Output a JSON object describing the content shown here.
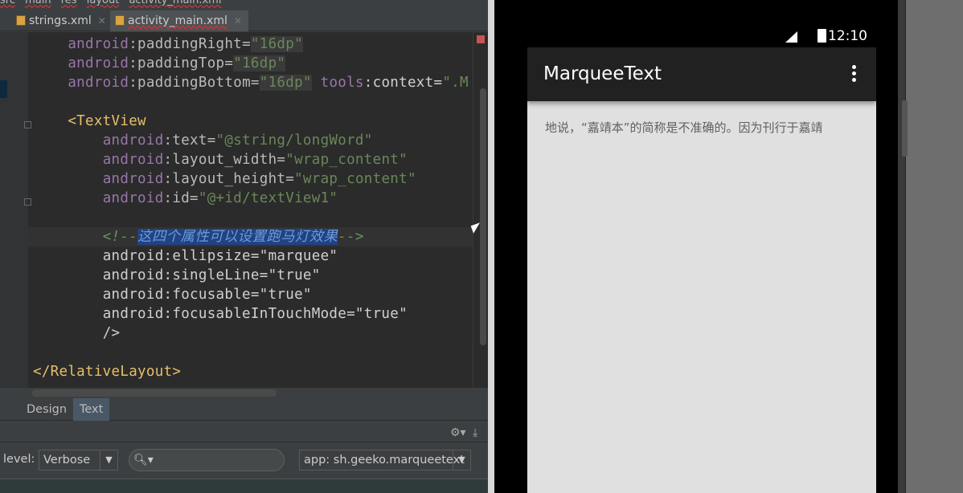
{
  "breadcrumb": [
    "src",
    "main",
    "res",
    "layout",
    "activity_main.xml"
  ],
  "editor_tabs": [
    {
      "label": "strings.xml",
      "active": false
    },
    {
      "label": "activity_main.xml",
      "active": true
    }
  ],
  "code_lines": [
    [
      [
        "    ",
        ""
      ],
      [
        "android",
        "ns"
      ],
      [
        ":paddingRight=",
        "at"
      ],
      [
        "\"16dp\"",
        "qd"
      ]
    ],
    [
      [
        "    ",
        ""
      ],
      [
        "android",
        "ns"
      ],
      [
        ":paddingTop=",
        "at"
      ],
      [
        "\"16dp\"",
        "qd"
      ]
    ],
    [
      [
        "    ",
        ""
      ],
      [
        "android",
        "ns"
      ],
      [
        ":paddingBottom=",
        "at"
      ],
      [
        "\"16dp\"",
        "qd"
      ],
      [
        " ",
        ""
      ],
      [
        "tools",
        "ns"
      ],
      [
        ":context=",
        "pl"
      ],
      [
        "\".M",
        "val"
      ]
    ],
    [],
    [
      [
        "    ",
        ""
      ],
      [
        "<TextView",
        "tag"
      ]
    ],
    [
      [
        "        ",
        ""
      ],
      [
        "android",
        "ns"
      ],
      [
        ":text=",
        "at"
      ],
      [
        "\"@string/longWord\"",
        "val"
      ]
    ],
    [
      [
        "        ",
        ""
      ],
      [
        "android",
        "ns"
      ],
      [
        ":layout_width=",
        "at"
      ],
      [
        "\"wrap_content\"",
        "val"
      ]
    ],
    [
      [
        "        ",
        ""
      ],
      [
        "android",
        "ns"
      ],
      [
        ":layout_height=",
        "at"
      ],
      [
        "\"wrap_content\"",
        "val"
      ]
    ],
    [
      [
        "        ",
        ""
      ],
      [
        "android",
        "ns"
      ],
      [
        ":id=",
        "at"
      ],
      [
        "\"@+id/textView1\"",
        "val"
      ]
    ],
    [],
    [
      [
        "        ",
        ""
      ],
      [
        "<!--",
        "cm"
      ],
      [
        "这四个属性可以设置跑马灯效果",
        "sel"
      ],
      [
        "-->",
        "cm"
      ]
    ],
    [
      [
        "        ",
        ""
      ],
      [
        "android:ellipsize=\"marquee\"",
        "pl"
      ]
    ],
    [
      [
        "        ",
        ""
      ],
      [
        "android:singleLine=\"true\"",
        "pl"
      ]
    ],
    [
      [
        "        ",
        ""
      ],
      [
        "android:focusable=\"true\"",
        "pl"
      ]
    ],
    [
      [
        "        ",
        ""
      ],
      [
        "android:focusableInTouchMode=\"true\"",
        "pl"
      ]
    ],
    [
      [
        "        ",
        ""
      ],
      [
        "/>",
        "pl"
      ]
    ],
    [],
    [
      [
        "</RelativeLayout>",
        "tag"
      ]
    ]
  ],
  "current_line": 10,
  "bottom_tabs": {
    "design": "Design",
    "text": "Text",
    "active": "Text"
  },
  "logcat": {
    "level_label": "level:",
    "level_value": "Verbose",
    "search_value": "",
    "app_filter": "app: sh.geeko.marqueetext"
  },
  "phone": {
    "time": "12:10",
    "app_title": "MarqueeText",
    "marquee_text": "地说，“嘉靖本”的简称是不准确的。因为刊行于嘉靖"
  }
}
